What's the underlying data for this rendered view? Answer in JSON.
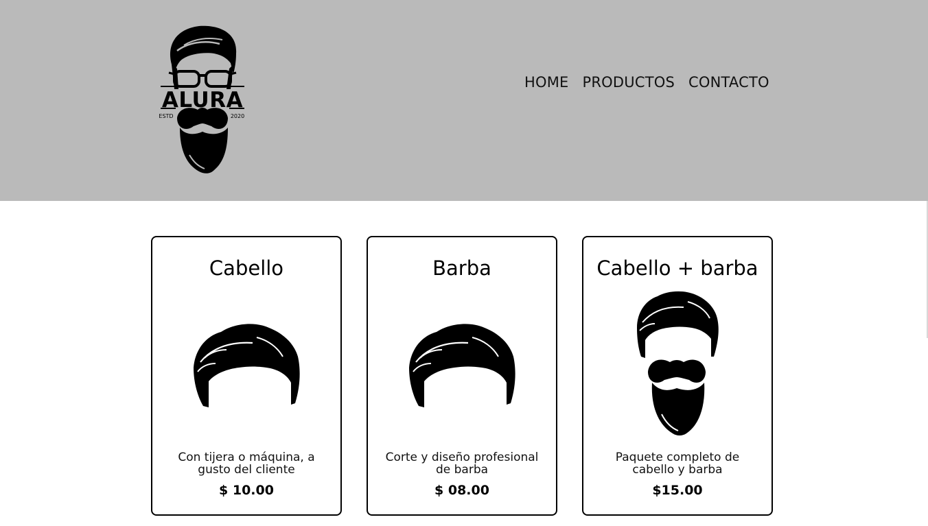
{
  "header": {
    "logo": {
      "brand": "ALURA",
      "left_text": "ESTD",
      "right_text": "2020",
      "icon": "bearded-man-glasses-logo"
    },
    "nav": [
      {
        "label": "HOME"
      },
      {
        "label": "PRODUCTOS"
      },
      {
        "label": "CONTACTO"
      }
    ]
  },
  "products": [
    {
      "title": "Cabello",
      "image": "hair-icon",
      "description": "Con tijera o máquina, a gusto del cliente",
      "price": "$ 10.00"
    },
    {
      "title": "Barba",
      "image": "hair-icon",
      "description": "Corte y diseño profesional de barba",
      "price": "$ 08.00"
    },
    {
      "title": "Cabello + barba",
      "image": "hair-and-beard-icon",
      "description": "Paquete completo de cabello y barba",
      "price": "$15.00"
    }
  ],
  "colors": {
    "header_bg": "#bababa",
    "page_bg": "#ffffff",
    "text": "#000000"
  }
}
